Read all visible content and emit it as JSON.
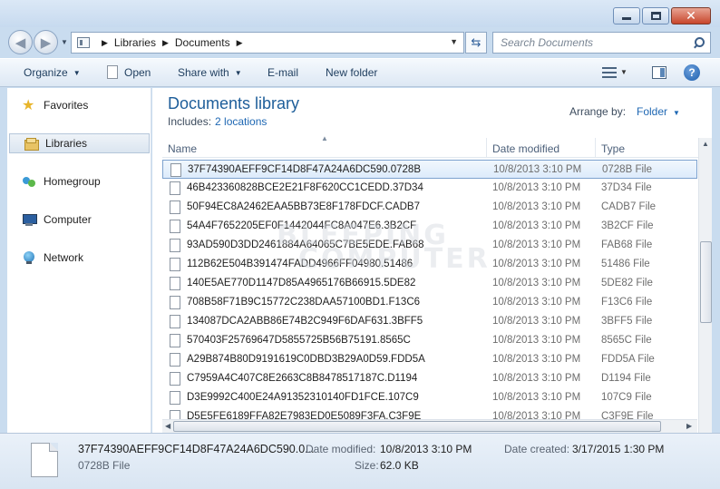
{
  "window": {
    "minimize": "minimize",
    "maximize": "maximize",
    "close": "✕"
  },
  "address": {
    "crumbs": [
      "Libraries",
      "Documents"
    ],
    "search_placeholder": "Search Documents"
  },
  "toolbar": {
    "organize": "Organize",
    "open": "Open",
    "share_with": "Share with",
    "email": "E-mail",
    "new_folder": "New folder"
  },
  "nav": {
    "favorites": "Favorites",
    "libraries": "Libraries",
    "homegroup": "Homegroup",
    "computer": "Computer",
    "network": "Network"
  },
  "library": {
    "title": "Documents library",
    "includes_label": "Includes:",
    "includes_link": "2 locations",
    "arrange_label": "Arrange by:",
    "arrange_value": "Folder"
  },
  "columns": {
    "name": "Name",
    "date": "Date modified",
    "type": "Type"
  },
  "files": [
    {
      "name": "37F74390AEFF9CF14D8F47A24A6DC590.0728B",
      "date": "10/8/2013 3:10 PM",
      "type": "0728B File"
    },
    {
      "name": "46B423360828BCE2E21F8F620CC1CEDD.37D34",
      "date": "10/8/2013 3:10 PM",
      "type": "37D34 File"
    },
    {
      "name": "50F94EC8A2462EAA5BB73E8F178FDCF.CADB7",
      "date": "10/8/2013 3:10 PM",
      "type": "CADB7 File"
    },
    {
      "name": "54A4F7652205EF0F1442044FC8A047E6.3B2CF",
      "date": "10/8/2013 3:10 PM",
      "type": "3B2CF File"
    },
    {
      "name": "93AD590D3DD2461884A64065C7BE5EDE.FAB68",
      "date": "10/8/2013 3:10 PM",
      "type": "FAB68 File"
    },
    {
      "name": "112B62E504B391474FADD4966FF04980.51486",
      "date": "10/8/2013 3:10 PM",
      "type": "51486 File"
    },
    {
      "name": "140E5AE770D1147D85A4965176B66915.5DE82",
      "date": "10/8/2013 3:10 PM",
      "type": "5DE82 File"
    },
    {
      "name": "708B58F71B9C15772C238DAA57100BD1.F13C6",
      "date": "10/8/2013 3:10 PM",
      "type": "F13C6 File"
    },
    {
      "name": "134087DCA2ABB86E74B2C949F6DAF631.3BFF5",
      "date": "10/8/2013 3:10 PM",
      "type": "3BFF5 File"
    },
    {
      "name": "570403F25769647D5855725B56B75191.8565C",
      "date": "10/8/2013 3:10 PM",
      "type": "8565C File"
    },
    {
      "name": "A29B874B80D9191619C0DBD3B29A0D59.FDD5A",
      "date": "10/8/2013 3:10 PM",
      "type": "FDD5A File"
    },
    {
      "name": "C7959A4C407C8E2663C8B8478517187C.D1194",
      "date": "10/8/2013 3:10 PM",
      "type": "D1194 File"
    },
    {
      "name": "D3E9992C400E24A91352310140FD1FCE.107C9",
      "date": "10/8/2013 3:10 PM",
      "type": "107C9 File"
    },
    {
      "name": "D5E5FE6189FFA82E7983ED0E5089F3FA.C3F9E",
      "date": "10/8/2013 3:10 PM",
      "type": "C3F9E File"
    }
  ],
  "watermark": {
    "line1": "BLEEPING",
    "line2": "COMPUTER"
  },
  "details": {
    "name": "37F74390AEFF9CF14D8F47A24A6DC590.0...",
    "type": "0728B File",
    "date_modified_label": "Date modified:",
    "date_modified": "10/8/2013 3:10 PM",
    "date_created_label": "Date created:",
    "date_created": "3/17/2015 1:30 PM",
    "size_label": "Size:",
    "size": "62.0 KB"
  }
}
